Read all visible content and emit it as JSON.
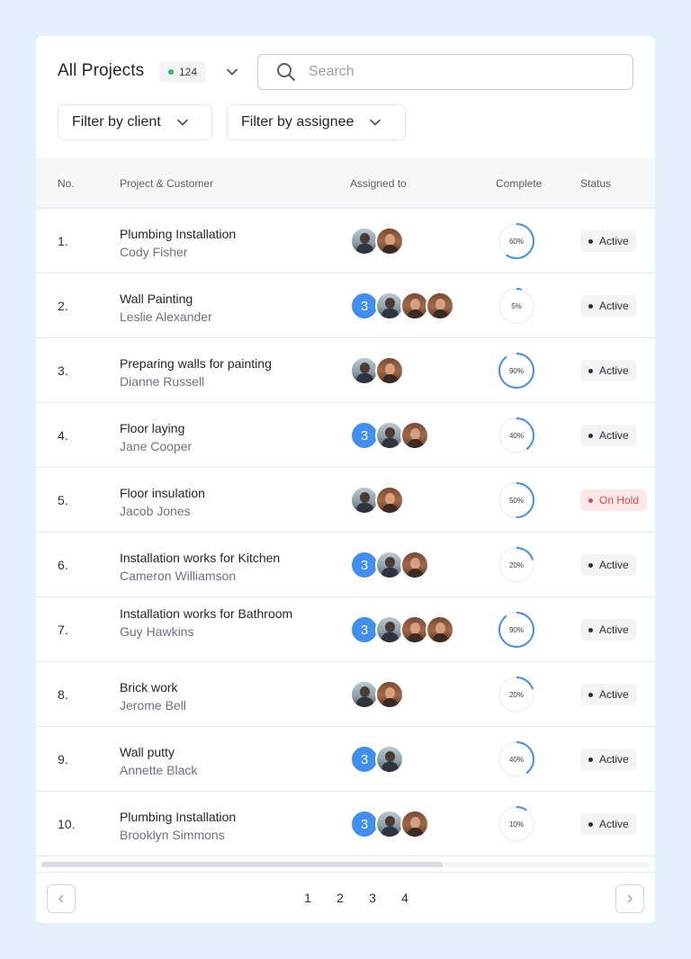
{
  "header": {
    "title": "All Projects",
    "count": "124",
    "search_placeholder": "Search",
    "filter_client": "Filter by client",
    "filter_assignee": "Filter by assignee"
  },
  "table": {
    "columns": [
      "No.",
      "Project & Customer",
      "Assigned to",
      "Complete",
      "Status"
    ],
    "rows": [
      {
        "no": "1.",
        "project": "Plumbing Installation",
        "customer": "Cody Fisher",
        "extra_count": null,
        "avatars": [
          "man",
          "woman"
        ],
        "complete": 60,
        "complete_label": "60%",
        "status": "Active",
        "status_type": "active"
      },
      {
        "no": "2.",
        "project": "Wall Painting",
        "customer": "Leslie Alexander",
        "extra_count": "3",
        "avatars": [
          "man",
          "woman",
          "woman"
        ],
        "complete": 5,
        "complete_label": "5%",
        "status": "Active",
        "status_type": "active"
      },
      {
        "no": "3.",
        "project": "Preparing walls for painting",
        "customer": "Dianne Russell",
        "extra_count": null,
        "avatars": [
          "man",
          "woman"
        ],
        "complete": 90,
        "complete_label": "90%",
        "status": "Active",
        "status_type": "active"
      },
      {
        "no": "4.",
        "project": "Floor laying",
        "customer": "Jane Cooper",
        "extra_count": "3",
        "avatars": [
          "man",
          "woman"
        ],
        "complete": 40,
        "complete_label": "40%",
        "status": "Active",
        "status_type": "active"
      },
      {
        "no": "5.",
        "project": "Floor insulation",
        "customer": "Jacob Jones",
        "extra_count": null,
        "avatars": [
          "man",
          "woman"
        ],
        "complete": 50,
        "complete_label": "50%",
        "status": "On Hold",
        "status_type": "hold"
      },
      {
        "no": "6.",
        "project": "Installation works for Kitchen",
        "customer": "Cameron Williamson",
        "extra_count": "3",
        "avatars": [
          "man",
          "woman"
        ],
        "complete": 20,
        "complete_label": "20%",
        "status": "Active",
        "status_type": "active"
      },
      {
        "no": "7.",
        "project": "Installation works for Bathroom",
        "customer": "Guy Hawkins",
        "extra_count": "3",
        "avatars": [
          "man",
          "woman",
          "woman"
        ],
        "complete": 90,
        "complete_label": "90%",
        "status": "Active",
        "status_type": "active"
      },
      {
        "no": "8.",
        "project": "Brick work",
        "customer": "Jerome Bell",
        "extra_count": null,
        "avatars": [
          "man",
          "woman"
        ],
        "complete": 20,
        "complete_label": "20%",
        "status": "Active",
        "status_type": "active"
      },
      {
        "no": "9.",
        "project": "Wall putty",
        "customer": "Annette Black",
        "extra_count": "3",
        "avatars": [
          "man"
        ],
        "complete": 40,
        "complete_label": "40%",
        "status": "Active",
        "status_type": "active"
      },
      {
        "no": "10.",
        "project": "Plumbing Installation",
        "customer": "Brooklyn Simmons",
        "extra_count": "3",
        "avatars": [
          "man",
          "woman"
        ],
        "complete": 10,
        "complete_label": "10%",
        "status": "Active",
        "status_type": "active"
      }
    ]
  },
  "pagination": {
    "pages": [
      "1",
      "2",
      "3",
      "4"
    ],
    "prev_icon": "chevron-left-icon",
    "next_icon": "chevron-right-icon"
  },
  "colors": {
    "accent": "#3f8ef0",
    "active_dot": "#2ebd5f",
    "hold": "#e0494a",
    "background": "#e4f1fd"
  }
}
